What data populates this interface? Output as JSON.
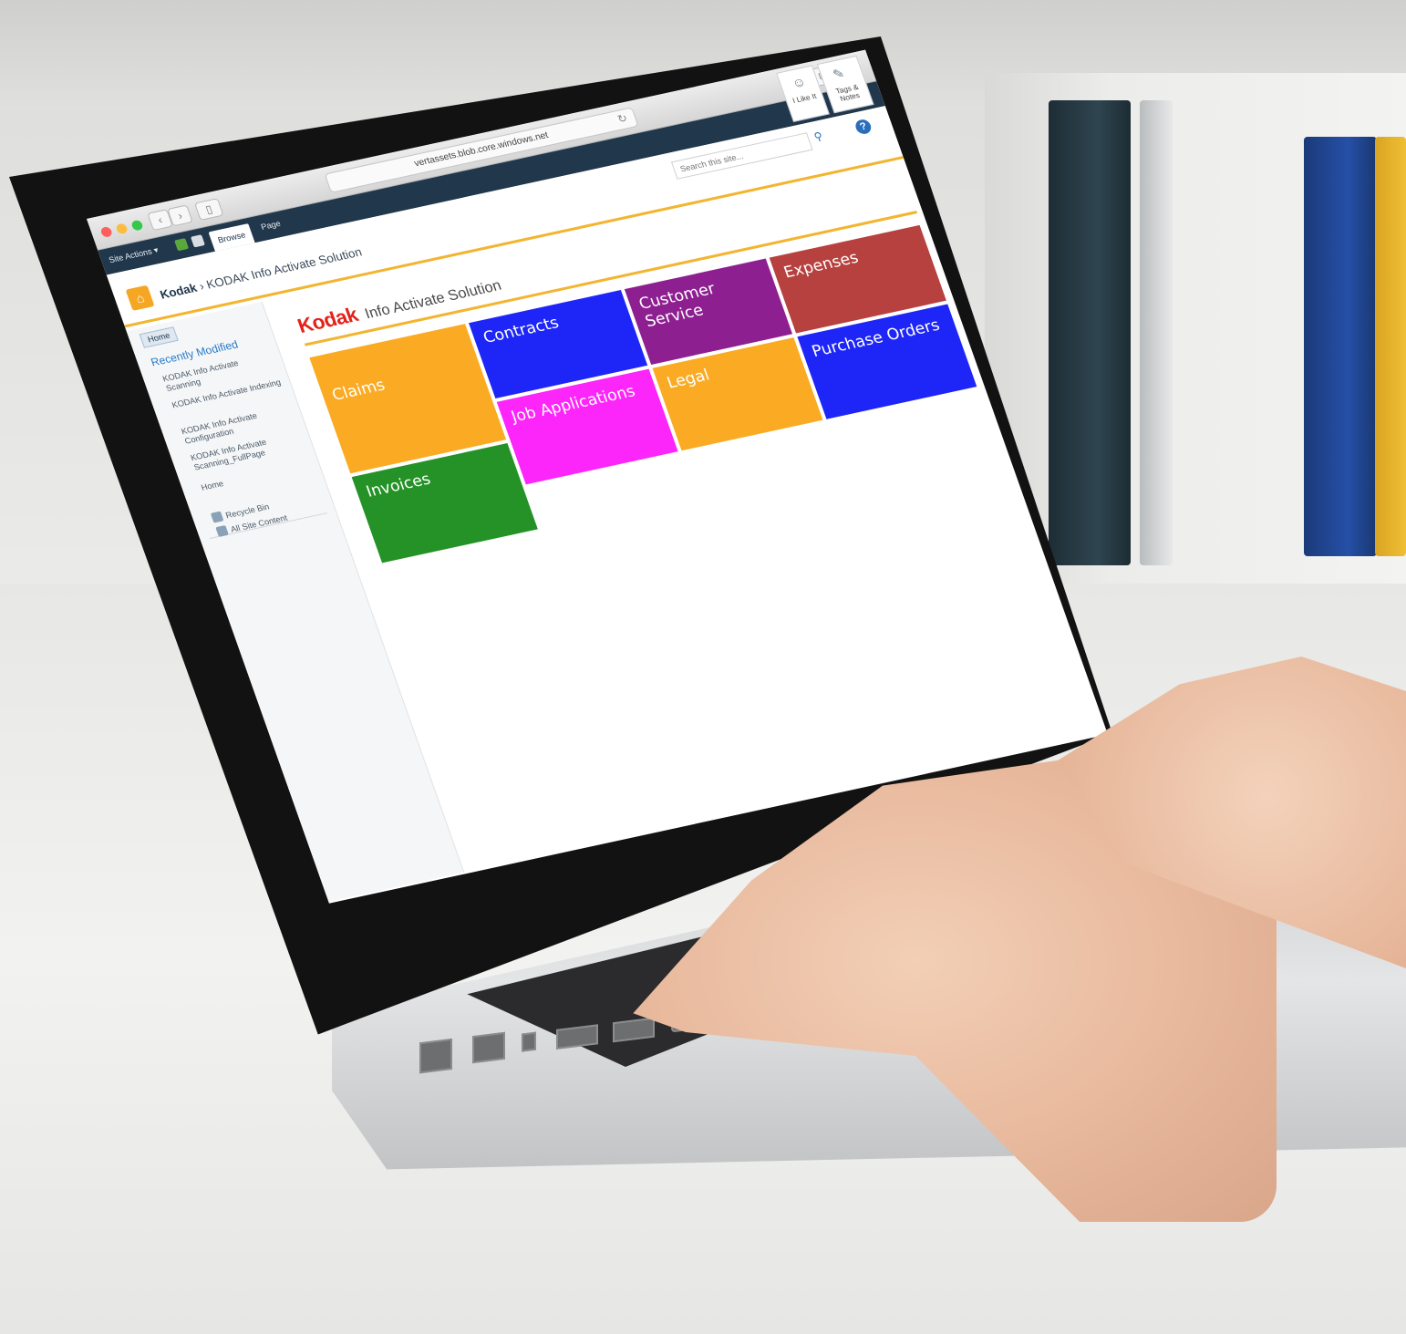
{
  "browser": {
    "url": "vertassets.blob.core.windows.net",
    "reload_icon": "reload-icon"
  },
  "ribbon": {
    "site_actions": "Site Actions ▾",
    "tabs": [
      {
        "label": "Browse",
        "active": true
      },
      {
        "label": "Page",
        "active": false
      }
    ],
    "actions": [
      {
        "label": "I Like It",
        "icon": "thumbs-up-icon"
      },
      {
        "label": "Tags & Notes",
        "icon": "tag-icon"
      }
    ]
  },
  "header": {
    "site_name": "Kodak",
    "separator": "›",
    "page_name": "KODAK Info Activate Solution",
    "search_placeholder": "Search this site..."
  },
  "leftnav": {
    "home_tab": "Home",
    "heading": "Recently Modified",
    "items": [
      "KODAK Info Activate Scanning",
      "KODAK Info Activate Indexing",
      "KODAK Info Activate Configuration",
      "KODAK Info Activate Scanning_FullPage",
      "Home"
    ],
    "utility": [
      {
        "label": "Recycle Bin",
        "icon": "recycle-bin-icon"
      },
      {
        "label": "All Site Content",
        "icon": "site-content-icon"
      }
    ]
  },
  "brand": {
    "logo": "Kodak",
    "title": "Info Activate Solution",
    "accent": "#f3b531",
    "logo_color": "#e2231a"
  },
  "tiles": [
    {
      "label": "Claims",
      "color": "#fbab23"
    },
    {
      "label": "Contracts",
      "color": "#1e26f7"
    },
    {
      "label": "Customer Service",
      "color": "#8e1f91"
    },
    {
      "label": "Expenses",
      "color": "#b6413e"
    },
    {
      "label": "Invoices",
      "color": "#249226"
    },
    {
      "label": "Job Applications",
      "color": "#fc25fa"
    },
    {
      "label": "Legal",
      "color": "#fbab23"
    },
    {
      "label": "Purchase Orders",
      "color": "#1e26f7"
    }
  ]
}
